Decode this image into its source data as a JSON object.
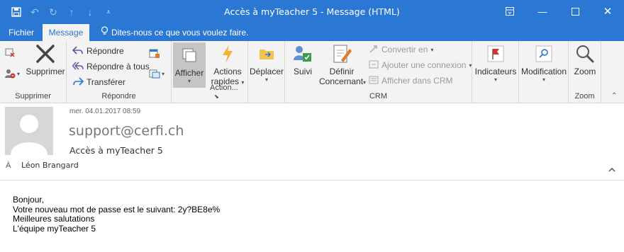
{
  "window": {
    "title": "Accès à myTeacher 5 - Message (HTML)",
    "qat_icons": [
      "save-icon",
      "undo-icon",
      "redo-icon",
      "up-icon",
      "down-icon",
      "customize-icon"
    ]
  },
  "tabs": {
    "fichier": "Fichier",
    "message": "Message",
    "tell_me": "Dites-nous ce que vous voulez faire."
  },
  "ribbon": {
    "supprimer": {
      "label": "Supprimer",
      "group": "Supprimer"
    },
    "repondre": {
      "group": "Répondre",
      "reply": "Répondre",
      "reply_all": "Répondre à tous",
      "forward": "Transférer"
    },
    "afficher": "Afficher",
    "actions": {
      "line1": "Actions",
      "line2": "rapides",
      "group": "Action..."
    },
    "deplacer": "Déplacer",
    "crm": {
      "suivi": "Suivi",
      "definir_line1": "Définir",
      "definir_line2": "Concernant",
      "convertir": "Convertir en",
      "ajouter": "Ajouter une connexion",
      "afficher_crm": "Afficher dans CRM",
      "group": "CRM"
    },
    "indicateurs": "Indicateurs",
    "modification": "Modification",
    "zoom": {
      "label": "Zoom",
      "group": "Zoom"
    }
  },
  "message": {
    "date": "mer. 04.01.2017 08:59",
    "sender": "support@cerfi.ch",
    "subject": "Accès à myTeacher 5",
    "to_label": "À",
    "to_name": "Léon Brangard",
    "body": [
      "Bonjour,",
      "Votre nouveau mot de passe est le suivant: 2y?BE8e%",
      "Meilleures salutations",
      "L'équipe myTeacher 5"
    ]
  }
}
